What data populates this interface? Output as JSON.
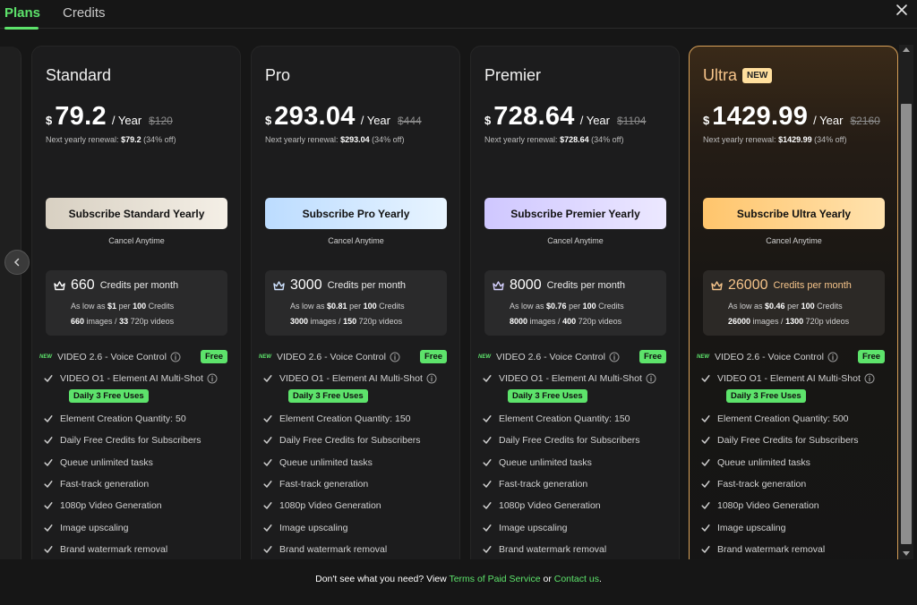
{
  "tabs": [
    {
      "label": "Plans",
      "active": true
    },
    {
      "label": "Credits",
      "active": false
    }
  ],
  "colors": {
    "accent": "#5de36b"
  },
  "plans": [
    {
      "name": "Standard",
      "currency": "$",
      "price": "79.2",
      "period": "/ Year",
      "original": "$120",
      "renewal_label": "Next yearly renewal:",
      "renewal_value": "$79.2",
      "renewal_off": "(34% off)",
      "button": "Subscribe Standard Yearly",
      "cancel": "Cancel Anytime",
      "credits": "660",
      "credits_label": "Credits per month",
      "as_low_as": "As low as",
      "unit_price": "$1",
      "per": "per",
      "per_count": "100",
      "per_unit": "Credits",
      "images": "660",
      "images_label": "images /",
      "videos": "33",
      "videos_label": "720p videos",
      "element_qty": "Element Creation Quantity: 50"
    },
    {
      "name": "Pro",
      "currency": "$",
      "price": "293.04",
      "period": "/ Year",
      "original": "$444",
      "renewal_label": "Next yearly renewal:",
      "renewal_value": "$293.04",
      "renewal_off": "(34% off)",
      "button": "Subscribe Pro Yearly",
      "cancel": "Cancel Anytime",
      "credits": "3000",
      "credits_label": "Credits per month",
      "as_low_as": "As low as",
      "unit_price": "$0.81",
      "per": "per",
      "per_count": "100",
      "per_unit": "Credits",
      "images": "3000",
      "images_label": "images /",
      "videos": "150",
      "videos_label": "720p videos",
      "element_qty": "Element Creation Quantity: 150"
    },
    {
      "name": "Premier",
      "currency": "$",
      "price": "728.64",
      "period": "/ Year",
      "original": "$1104",
      "renewal_label": "Next yearly renewal:",
      "renewal_value": "$728.64",
      "renewal_off": "(34% off)",
      "button": "Subscribe Premier Yearly",
      "cancel": "Cancel Anytime",
      "credits": "8000",
      "credits_label": "Credits per month",
      "as_low_as": "As low as",
      "unit_price": "$0.76",
      "per": "per",
      "per_count": "100",
      "per_unit": "Credits",
      "images": "8000",
      "images_label": "images /",
      "videos": "400",
      "videos_label": "720p videos",
      "element_qty": "Element Creation Quantity: 150"
    },
    {
      "name": "Ultra",
      "badge": "NEW",
      "currency": "$",
      "price": "1429.99",
      "period": "/ Year",
      "original": "$2160",
      "renewal_label": "Next yearly renewal:",
      "renewal_value": "$1429.99",
      "renewal_off": "(34% off)",
      "button": "Subscribe Ultra Yearly",
      "cancel": "Cancel Anytime",
      "credits": "26000",
      "credits_label": "Credits per month",
      "as_low_as": "As low as",
      "unit_price": "$0.46",
      "per": "per",
      "per_count": "100",
      "per_unit": "Credits",
      "images": "26000",
      "images_label": "images /",
      "videos": "1300",
      "videos_label": "720p videos",
      "element_qty": "Element Creation Quantity: 500"
    }
  ],
  "features": {
    "new_tag": "NEW",
    "video26": "VIDEO 2.6 - Voice Control",
    "free_badge": "Free",
    "videoO1": "VIDEO O1 - Element AI Multi-Shot",
    "daily_badge": "Daily 3 Free Uses",
    "daily_credits": "Daily Free Credits for Subscribers",
    "queue": "Queue unlimited tasks",
    "fasttrack": "Fast-track generation",
    "video1080": "1080p Video Generation",
    "upscaling": "Image upscaling",
    "watermark": "Brand watermark removal"
  },
  "footer": {
    "text": "Don't see what you need? View",
    "terms_link": "Terms of Paid Service",
    "or": "or",
    "contact_link": "Contact us",
    "period": "."
  }
}
